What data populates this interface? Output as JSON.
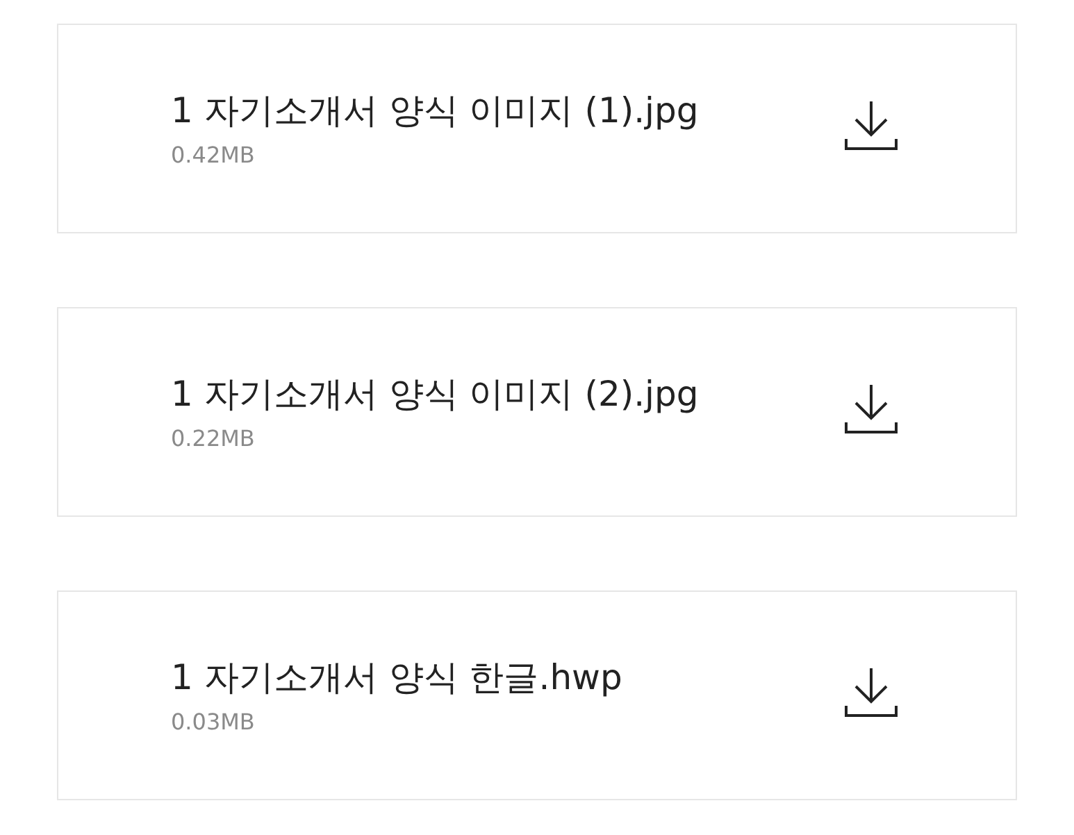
{
  "files": [
    {
      "name": "1 자기소개서 양식 이미지 (1).jpg",
      "size": "0.42MB"
    },
    {
      "name": "1 자기소개서 양식 이미지 (2).jpg",
      "size": "0.22MB"
    },
    {
      "name": "1 자기소개서 양식 한글.hwp",
      "size": "0.03MB"
    }
  ]
}
